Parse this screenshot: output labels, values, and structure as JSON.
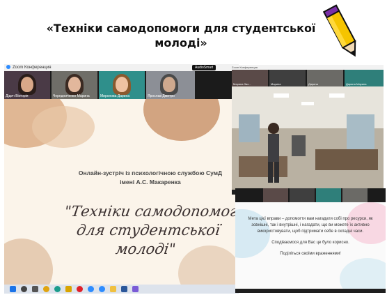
{
  "heading": {
    "line1": "«Техніки самодопомоги для студентської",
    "line2": "молоді»"
  },
  "main_window": {
    "title": "Zoom Конференция",
    "badge": "AudioSmart",
    "participants": [
      {
        "name": "Дідич Вікторія"
      },
      {
        "name": "Чередниченко Марина"
      },
      {
        "name": "Миронова Дарина"
      },
      {
        "name": "Ярослав Дмитро"
      }
    ],
    "slide": {
      "subtitle_line1": "Онлайн-зустріч із психологічною службою СумД",
      "subtitle_line2": "імені А.С. Макаренка",
      "script_line1": "\"Техніки самодопомог",
      "script_line2": "для студентської",
      "script_line3": "молоді\""
    }
  },
  "right_window": {
    "title": "Zoom Конференция",
    "participants": [
      {
        "name": "Марина Зах..."
      },
      {
        "name": "Марина"
      },
      {
        "name": "Дарина"
      },
      {
        "name": "Дарина Марина"
      }
    ]
  },
  "presentation": {
    "paragraph1": "Мета цієї вправи – допомогти вам нагадати собі про ресурси, як зовнішні, так і внутрішні, і нагадати, що ви можете їх активно використовувати, щоб підтримати себе в складні часи.",
    "paragraph2": "Сподіваємося для Вас це було корисно.",
    "paragraph3": "Поділіться своїми враженнями!"
  },
  "taskbar_icons": [
    "windows-icon",
    "search-icon",
    "taskview-icon",
    "chrome-icon",
    "edge-icon",
    "explorer-icon",
    "opera-icon",
    "zoom-icon",
    "zoom-icon",
    "folder-icon",
    "word-icon",
    "app-icon"
  ],
  "colors": {
    "zoom_blue": "#2d8cff",
    "taskbar": "#dde3ec",
    "slide_bg": "#fbf4ea"
  }
}
